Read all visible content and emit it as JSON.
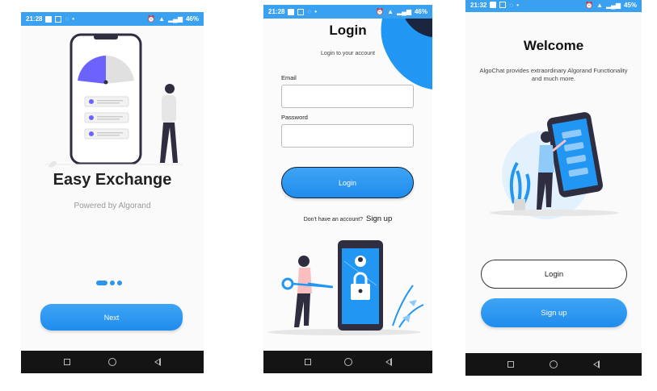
{
  "screens": [
    {
      "status": {
        "time": "21:28",
        "battery": "46%"
      },
      "title": "Easy Exchange",
      "subtitle": "Powered by Algorand",
      "next_label": "Next"
    },
    {
      "status": {
        "time": "21:28",
        "battery": "46%"
      },
      "title": "Login",
      "subtitle": "Login to your account",
      "email_label": "Email",
      "email_value": "",
      "password_label": "Password",
      "password_value": "",
      "login_label": "Login",
      "no_account_text": "Don't have an account?",
      "signup_link": "Sign up"
    },
    {
      "status": {
        "time": "21:32",
        "battery": "45%"
      },
      "title": "Welcome",
      "description": "AlgoChat provides extraordinary Algorand Functionality and much more.",
      "login_label": "Login",
      "signup_label": "Sign up"
    }
  ],
  "colors": {
    "primary": "#2196F3",
    "statusbar": "#3aa0f0",
    "navbar": "#141414"
  }
}
